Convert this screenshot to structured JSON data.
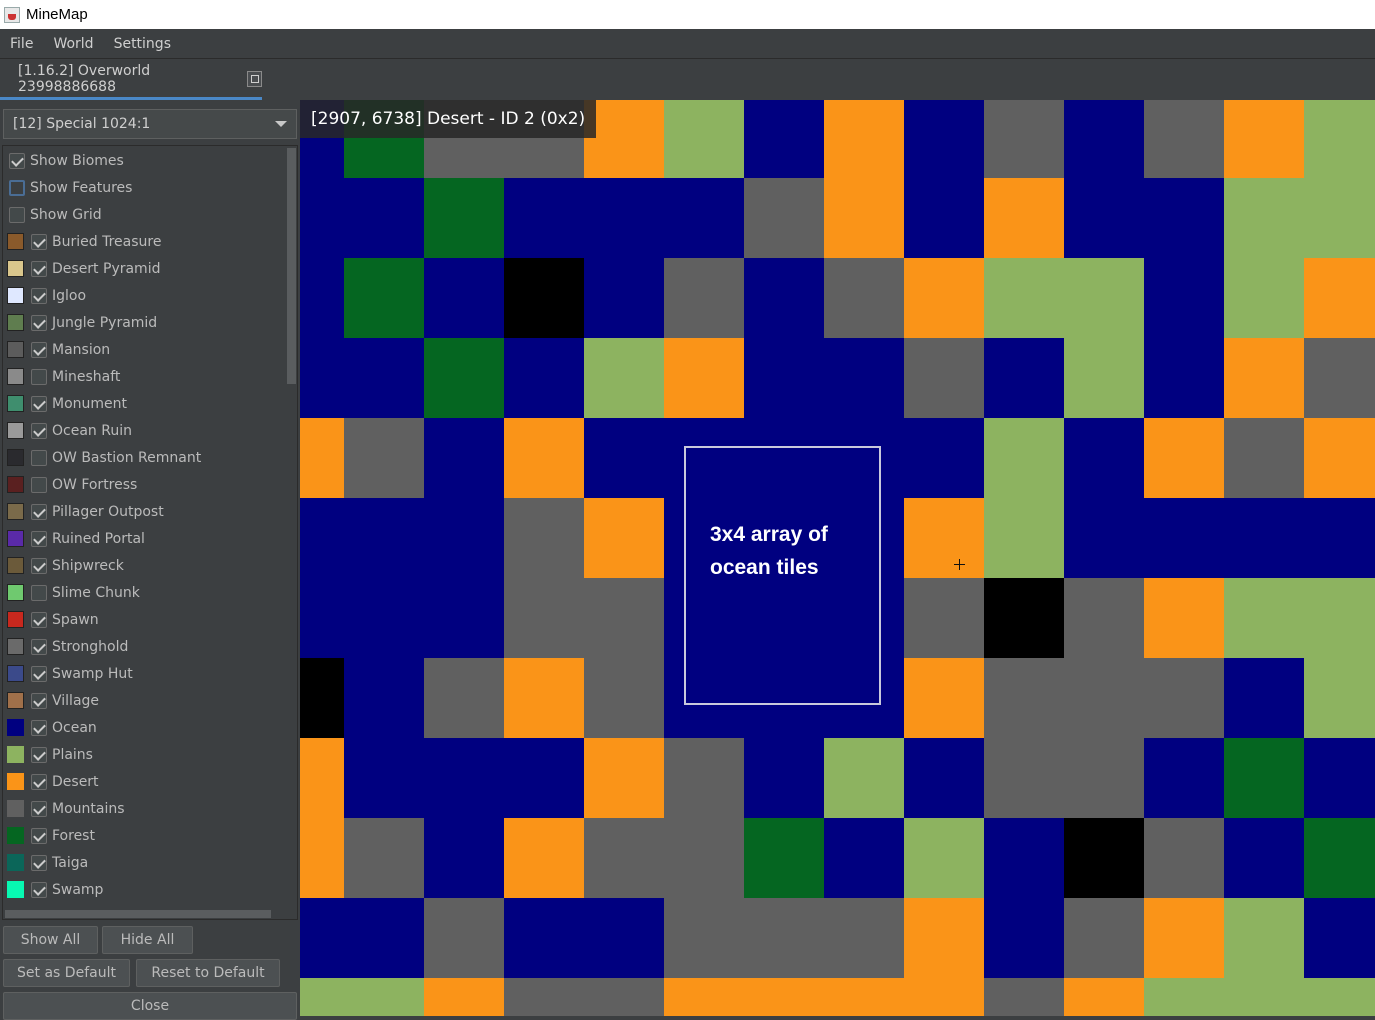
{
  "window": {
    "title": "MineMap"
  },
  "menu": [
    "File",
    "World",
    "Settings"
  ],
  "tab": {
    "label": "[1.16.2] Overworld 23998886688"
  },
  "zoom": {
    "selected": "[12] Special 1024:1"
  },
  "toggles": [
    {
      "label": "Show Biomes",
      "checked": true
    },
    {
      "label": "Show Features",
      "checked": false,
      "focused": true
    },
    {
      "label": "Show Grid",
      "checked": false
    }
  ],
  "features": [
    {
      "label": "Buried Treasure",
      "checked": true,
      "icon": "buried-treasure-icon"
    },
    {
      "label": "Desert Pyramid",
      "checked": true,
      "icon": "desert-pyramid-icon"
    },
    {
      "label": "Igloo",
      "checked": true,
      "icon": "igloo-icon"
    },
    {
      "label": "Jungle Pyramid",
      "checked": true,
      "icon": "jungle-pyramid-icon"
    },
    {
      "label": "Mansion",
      "checked": true,
      "icon": "mansion-icon"
    },
    {
      "label": "Mineshaft",
      "checked": false,
      "icon": "mineshaft-icon"
    },
    {
      "label": "Monument",
      "checked": true,
      "icon": "monument-icon"
    },
    {
      "label": "Ocean Ruin",
      "checked": true,
      "icon": "ocean-ruin-icon"
    },
    {
      "label": "OW Bastion Remnant",
      "checked": false,
      "icon": "bastion-remnant-icon"
    },
    {
      "label": "OW Fortress",
      "checked": false,
      "icon": "fortress-icon"
    },
    {
      "label": "Pillager Outpost",
      "checked": true,
      "icon": "pillager-outpost-icon"
    },
    {
      "label": "Ruined Portal",
      "checked": true,
      "icon": "ruined-portal-icon"
    },
    {
      "label": "Shipwreck",
      "checked": true,
      "icon": "shipwreck-icon"
    },
    {
      "label": "Slime Chunk",
      "checked": false,
      "icon": "slime-chunk-icon"
    },
    {
      "label": "Spawn",
      "checked": true,
      "icon": "spawn-icon"
    },
    {
      "label": "Stronghold",
      "checked": true,
      "icon": "stronghold-icon"
    },
    {
      "label": "Swamp Hut",
      "checked": true,
      "icon": "swamp-hut-icon"
    },
    {
      "label": "Village",
      "checked": true,
      "icon": "village-icon"
    }
  ],
  "biomes": [
    {
      "label": "Ocean",
      "checked": true,
      "color": "#000080"
    },
    {
      "label": "Plains",
      "checked": true,
      "color": "#8db360"
    },
    {
      "label": "Desert",
      "checked": true,
      "color": "#fa9418"
    },
    {
      "label": "Mountains",
      "checked": true,
      "color": "#606060"
    },
    {
      "label": "Forest",
      "checked": true,
      "color": "#056621"
    },
    {
      "label": "Taiga",
      "checked": true,
      "color": "#0b6659"
    },
    {
      "label": "Swamp",
      "checked": true,
      "color": "#07f9b2"
    }
  ],
  "icon_colors": {
    "buried-treasure-icon": "#8a5a2b",
    "desert-pyramid-icon": "#d9c68c",
    "igloo-icon": "#dfe8ff",
    "jungle-pyramid-icon": "#5f7d4f",
    "mansion-icon": "#5c5c5c",
    "mineshaft-icon": "#8a8a8a",
    "monument-icon": "#3f8e6e",
    "ocean-ruin-icon": "#9a9a9a",
    "bastion-remnant-icon": "#2a2a2e",
    "fortress-icon": "#5a2020",
    "pillager-outpost-icon": "#7a6a4a",
    "ruined-portal-icon": "#5a2aa8",
    "shipwreck-icon": "#6b5a3a",
    "slime-chunk-icon": "#6fc96f",
    "spawn-icon": "#c8281e",
    "stronghold-icon": "#6a6a6a",
    "swamp-hut-icon": "#3b4a8a",
    "village-icon": "#a0704a"
  },
  "buttons": {
    "show_all": "Show All",
    "hide_all": "Hide All",
    "set_default": "Set as Default",
    "reset_default": "Reset to Default",
    "close": "Close"
  },
  "map": {
    "tooltip": "[2907, 6738] Desert - ID 2 (0x2)",
    "annotation": "3x4 array of ocean tiles",
    "legend": {
      "O": "#000080",
      "P": "#8db360",
      "D": "#fa9418",
      "M": "#606060",
      "F": "#056621",
      "B": "#000000"
    },
    "rows": [
      "OFMMDPODOMOMDP",
      "OOFOOOMDODOOPP",
      "OFOBOMOMDPPOPD",
      "OOFOPDOOMOPODM",
      "DMODOOOOOPODMD",
      "OOOMDOOODPOOOO",
      "OOOMMOOOMBMDPP",
      "BOMDMOOODMMMOP",
      "DOOODMOPOMMOFO",
      "DMODMMFOPOBMOF",
      "OOMOOMMMDOMDPO",
      "PPDMMDDDDMDPPP"
    ]
  }
}
